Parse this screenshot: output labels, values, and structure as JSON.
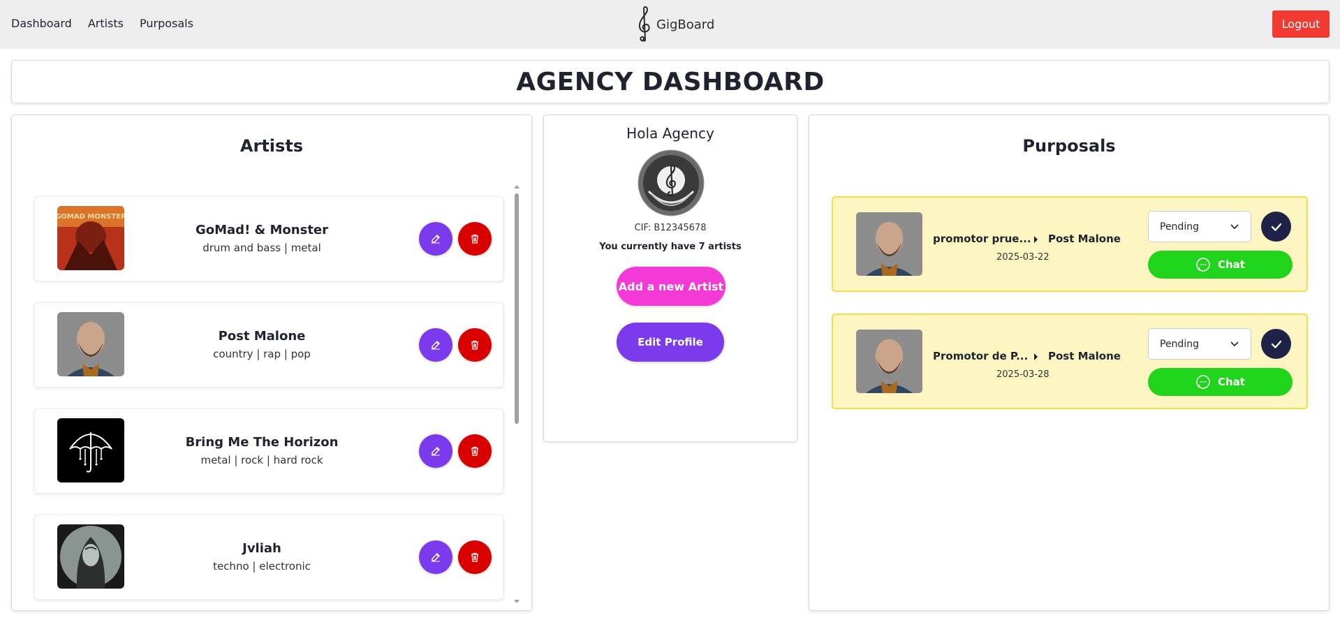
{
  "nav": {
    "links": [
      {
        "label": "Dashboard"
      },
      {
        "label": "Artists"
      },
      {
        "label": "Purposals"
      }
    ],
    "brand": "GigBoard",
    "logout_label": "Logout"
  },
  "page_title": "AGENCY DASHBOARD",
  "artists_panel": {
    "title": "Artists",
    "items": [
      {
        "name": "GoMad! & Monster",
        "genres": "drum and bass | metal",
        "image": "album-cover-red"
      },
      {
        "name": "Post Malone",
        "genres": "country | rap | pop",
        "image": "portrait-photo"
      },
      {
        "name": "Bring Me The Horizon",
        "genres": "metal | rock | hard rock",
        "image": "umbrella-logo"
      },
      {
        "name": "Jvliah",
        "genres": "techno | electronic",
        "image": "hooded-figure"
      }
    ]
  },
  "profile": {
    "name": "Hola Agency",
    "cif": "CIF: B12345678",
    "count_prefix": "You currently have ",
    "count": "7",
    "count_suffix": " artists",
    "add_artist_label": "Add a new Artist",
    "edit_profile_label": "Edit Profile"
  },
  "purposals_panel": {
    "title": "Purposals",
    "items": [
      {
        "promoter": "promotor prue...",
        "artist": "Post Malone",
        "date": "2025-03-22",
        "status": "Pending",
        "chat_label": "Chat"
      },
      {
        "promoter": "Promotor de P...",
        "artist": "Post Malone",
        "date": "2025-03-28",
        "status": "Pending",
        "chat_label": "Chat"
      }
    ]
  },
  "colors": {
    "edit_button": "#7c3aed",
    "delete_button": "#d90000",
    "logout": "#f03a32",
    "add_artist": "#f43ad6",
    "chat": "#1fd41a",
    "purposal_bg": "#fef6c2",
    "accept": "#1e2246"
  }
}
